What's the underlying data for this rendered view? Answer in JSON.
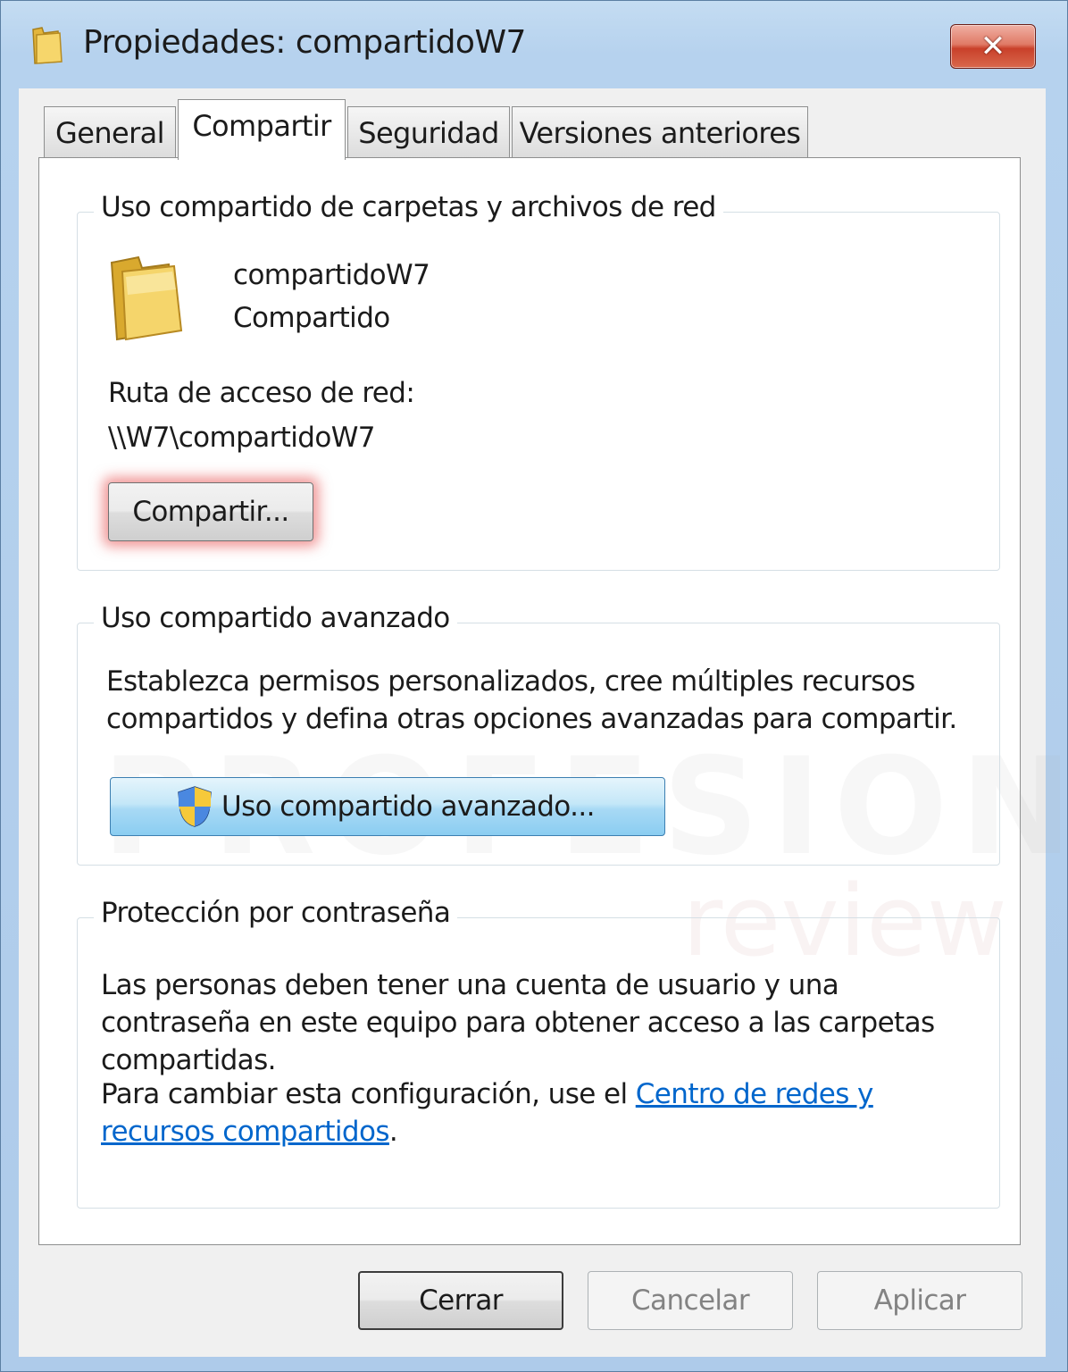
{
  "window": {
    "title": "Propiedades: compartidoW7",
    "close_label": "✕"
  },
  "tabs": [
    {
      "label": "General"
    },
    {
      "label": "Compartir"
    },
    {
      "label": "Seguridad"
    },
    {
      "label": "Versiones anteriores"
    }
  ],
  "network_sharing": {
    "legend": "Uso compartido de carpetas y archivos de red",
    "folder_name": "compartidoW7",
    "status": "Compartido",
    "path_label": "Ruta de acceso de red:",
    "path_value": "\\\\W7\\compartidoW7",
    "share_button": "Compartir..."
  },
  "advanced_sharing": {
    "legend": "Uso compartido avanzado",
    "description": "Establezca permisos personalizados, cree múltiples recursos compartidos y defina otras opciones avanzadas para compartir.",
    "button": "Uso compartido avanzado..."
  },
  "password_protection": {
    "legend": "Protección por contraseña",
    "description": "Las personas deben tener una cuenta de usuario y una contraseña en este equipo para obtener acceso a las carpetas compartidas.",
    "change_prefix": "Para cambiar esta configuración, use el ",
    "link_text": "Centro de redes y recursos compartidos",
    "change_suffix": "."
  },
  "footer": {
    "close": "Cerrar",
    "cancel": "Cancelar",
    "apply": "Aplicar"
  },
  "watermark": {
    "line1": "PROFESIONAL",
    "line2": "review"
  },
  "colors": {
    "link": "#0066cc",
    "focus_glow": "#e64646",
    "advanced_button": "#a7d9f5",
    "close_button": "#c9402a"
  }
}
